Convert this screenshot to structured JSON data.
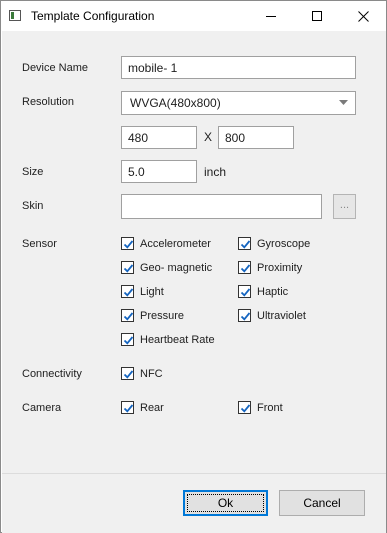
{
  "window": {
    "title": "Template Configuration",
    "controls": [
      "minimize",
      "maximize",
      "close"
    ]
  },
  "form": {
    "device_name": {
      "label": "Device Name",
      "value": "mobile- 1"
    },
    "resolution": {
      "label": "Resolution",
      "selected": "WVGA(480x800)",
      "width": "480",
      "separator": "X",
      "height": "800"
    },
    "size": {
      "label": "Size",
      "value": "5.0",
      "unit": "inch"
    },
    "skin": {
      "label": "Skin",
      "value": "",
      "browse_label": "..."
    },
    "sensor": {
      "label": "Sensor",
      "items": [
        {
          "label": "Accelerometer",
          "checked": true
        },
        {
          "label": "Gyroscope",
          "checked": true
        },
        {
          "label": "Geo- magnetic",
          "checked": true
        },
        {
          "label": "Proximity",
          "checked": true
        },
        {
          "label": "Light",
          "checked": true
        },
        {
          "label": "Haptic",
          "checked": true
        },
        {
          "label": "Pressure",
          "checked": true
        },
        {
          "label": "Ultraviolet",
          "checked": true
        },
        {
          "label": "Heartbeat Rate",
          "checked": true
        }
      ]
    },
    "connectivity": {
      "label": "Connectivity",
      "items": [
        {
          "label": "NFC",
          "checked": true
        }
      ]
    },
    "camera": {
      "label": "Camera",
      "items": [
        {
          "label": "Rear",
          "checked": true
        },
        {
          "label": "Front",
          "checked": true
        }
      ]
    }
  },
  "buttons": {
    "ok": "Ok",
    "cancel": "Cancel"
  },
  "colors": {
    "checkbox_mark": "#1565c0",
    "focus_border": "#0078d7"
  },
  "icons": {
    "minimize": "minimize-icon",
    "maximize": "maximize-icon",
    "close": "close-icon",
    "dropdown": "chevron-down-icon",
    "check": "check-icon"
  }
}
